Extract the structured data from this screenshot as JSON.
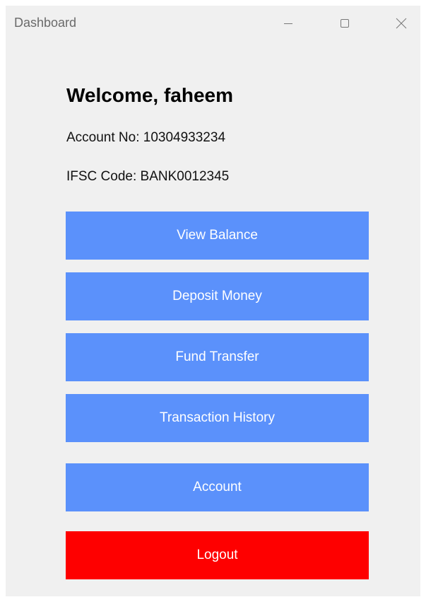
{
  "window": {
    "title": "Dashboard"
  },
  "welcome": {
    "heading": "Welcome, faheem",
    "account_no": "Account No: 10304933234",
    "ifsc_code": "IFSC Code: BANK0012345"
  },
  "actions": {
    "view_balance": "View Balance",
    "deposit_money": "Deposit Money",
    "fund_transfer": "Fund Transfer",
    "transaction_history": "Transaction History",
    "account": "Account",
    "logout": "Logout"
  },
  "colors": {
    "primary_button": "#5b91fb",
    "logout_button": "#fe0000",
    "window_background": "#f0f0f0"
  },
  "icons": {
    "minimize": "minimize-icon",
    "maximize": "maximize-icon",
    "close": "close-icon"
  }
}
